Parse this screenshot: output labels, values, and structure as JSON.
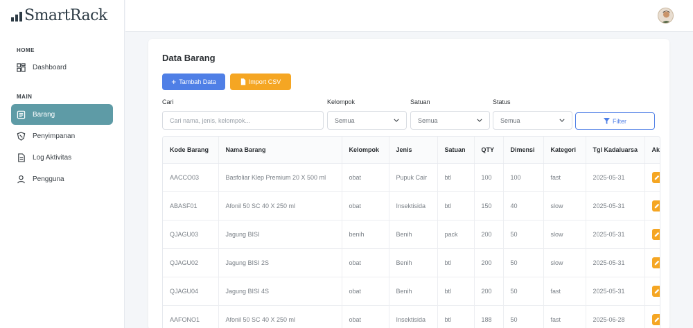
{
  "app": {
    "name": "SmartRack"
  },
  "sidebar": {
    "sections": [
      {
        "label": "HOME",
        "items": [
          {
            "label": "Dashboard",
            "icon": "dashboard-icon"
          }
        ]
      },
      {
        "label": "MAIN",
        "items": [
          {
            "label": "Barang",
            "icon": "list-icon",
            "active": true
          },
          {
            "label": "Penyimpanan",
            "icon": "shield-icon"
          },
          {
            "label": "Log Aktivitas",
            "icon": "document-icon"
          },
          {
            "label": "Pengguna",
            "icon": "user-icon"
          }
        ]
      }
    ]
  },
  "page": {
    "title": "Data Barang",
    "add_label": "Tambah Data",
    "import_label": "Import CSV",
    "filters": {
      "search_label": "Cari",
      "search_placeholder": "Cari nama, jenis, kelompok...",
      "kelompok_label": "Kelompok",
      "kelompok_value": "Semua",
      "satuan_label": "Satuan",
      "satuan_value": "Semua",
      "status_label": "Status",
      "status_value": "Semua",
      "filter_label": "Filter"
    }
  },
  "table": {
    "columns": [
      "Kode Barang",
      "Nama Barang",
      "Kelompok",
      "Jenis",
      "Satuan",
      "QTY",
      "Dimensi",
      "Kategori",
      "Tgl Kadaluarsa",
      "Aksi"
    ],
    "rows": [
      [
        "AACCO03",
        "Basfoliar Klep Premium 20 X 500 ml",
        "obat",
        "Pupuk Cair",
        "btl",
        "100",
        "100",
        "fast",
        "2025-05-31"
      ],
      [
        "ABASF01",
        "Afonil 50 SC 40 X 250 ml",
        "obat",
        "Insektisida",
        "btl",
        "150",
        "40",
        "slow",
        "2025-05-31"
      ],
      [
        "QJAGU03",
        "Jagung BISI",
        "benih",
        "Benih",
        "pack",
        "200",
        "50",
        "slow",
        "2025-05-31"
      ],
      [
        "QJAGU02",
        "Jagung BISI 2S",
        "obat",
        "Benih",
        "btl",
        "200",
        "50",
        "slow",
        "2025-05-31"
      ],
      [
        "QJAGU04",
        "Jagung BISI 4S",
        "obat",
        "Benih",
        "btl",
        "200",
        "50",
        "fast",
        "2025-05-31"
      ],
      [
        "AAFONO1",
        "Afonil 50 SC 40 X 250 ml",
        "obat",
        "Insektisida",
        "btl",
        "188",
        "50",
        "fast",
        "2025-06-28"
      ]
    ]
  },
  "colors": {
    "accent": "#5e9ba6",
    "primary": "#4f7fe6",
    "warning": "#f5a623"
  }
}
